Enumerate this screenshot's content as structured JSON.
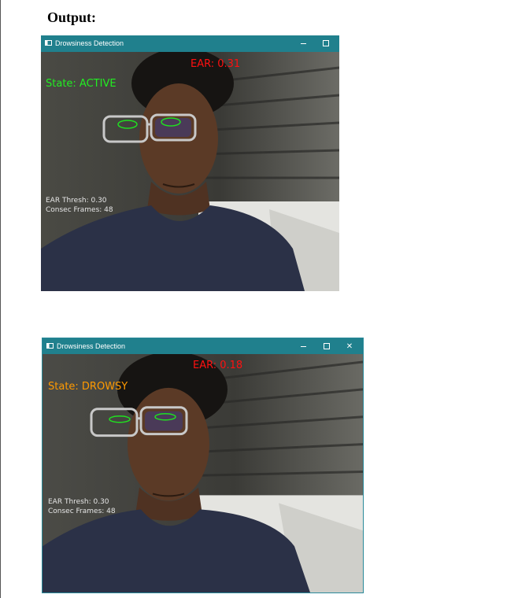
{
  "heading": "Output:",
  "colors": {
    "titlebar": "#20808d",
    "ear_text": "#ff1010",
    "active": "#22ee22",
    "drowsy": "#ff9a00",
    "info_text": "#e6e6e6",
    "eye_contour": "#20e020"
  },
  "icons": {
    "app": "app-window-icon",
    "minimize": "minimize-icon",
    "maximize": "maximize-icon",
    "close": "close-icon"
  },
  "windows": [
    {
      "title": "Drowsiness Detection",
      "ear": "EAR: 0.31",
      "state": "State: ACTIVE",
      "thresh": "EAR Thresh: 0.30",
      "frames": "Consec Frames: 48",
      "controls": [
        "—",
        "☐"
      ]
    },
    {
      "title": "Drowsiness Detection",
      "ear": "EAR: 0.18",
      "state": "State: DROWSY",
      "thresh": "EAR Thresh: 0.30",
      "frames": "Consec Frames: 48",
      "controls": [
        "—",
        "☐",
        "✕"
      ]
    }
  ]
}
